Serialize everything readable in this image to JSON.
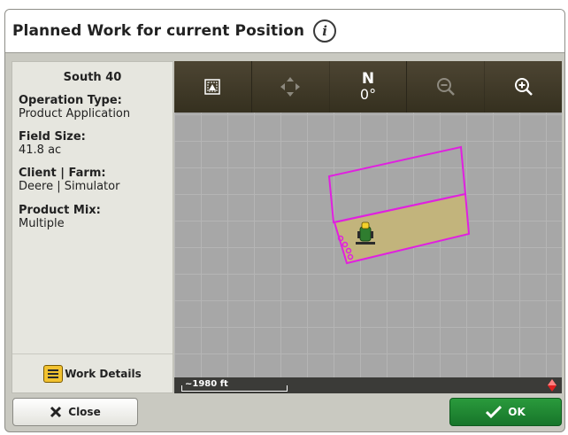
{
  "dialog": {
    "title": "Planned Work for current Position",
    "info_icon": "info-icon"
  },
  "field": {
    "name": "South 40",
    "operation_type_label": "Operation Type:",
    "operation_type_value": "Product Application",
    "field_size_label": "Field Size:",
    "field_size_value": "41.8 ac",
    "client_farm_label": "Client | Farm:",
    "client_farm_value": "Deere | Simulator",
    "product_mix_label": "Product Mix:",
    "product_mix_value": "Multiple"
  },
  "work_details": {
    "label": "Work Details",
    "icon": "list-icon"
  },
  "map": {
    "toolbar": {
      "tools": [
        "map-view-icon",
        "pan-icon",
        "heading-indicator",
        "zoom-out-icon",
        "zoom-in-icon"
      ],
      "heading_letter": "N",
      "heading_degrees": "0°"
    },
    "scale_label": "~1980 ft",
    "colors": {
      "boundary": "#e020e0",
      "applied_area": "#c2b47c",
      "grid_background": "#a7a7a7",
      "toolbar": "#3f3a28"
    }
  },
  "buttons": {
    "close_label": "Close",
    "ok_label": "OK",
    "ok_color": "#1f8a33"
  }
}
